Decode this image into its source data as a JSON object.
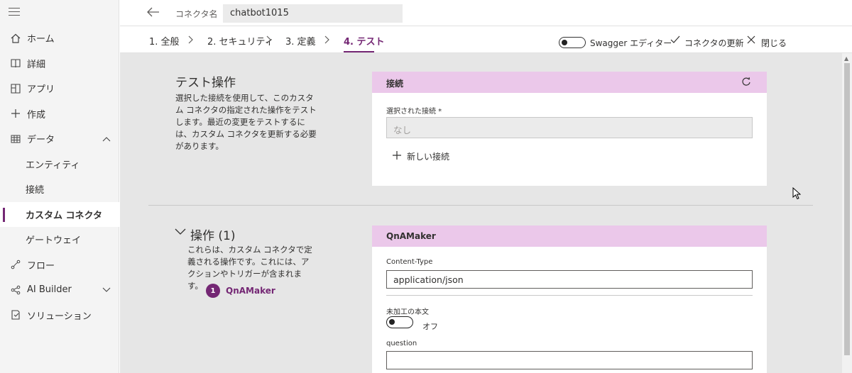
{
  "sidebar": {
    "items": [
      {
        "label": "ホーム",
        "icon": "home-icon"
      },
      {
        "label": "詳細",
        "icon": "book-icon"
      },
      {
        "label": "アプリ",
        "icon": "apps-icon"
      },
      {
        "label": "作成",
        "icon": "plus-icon"
      },
      {
        "label": "データ",
        "icon": "table-icon"
      },
      {
        "label": "エンティティ"
      },
      {
        "label": "接続"
      },
      {
        "label": "カスタム コネクタ"
      },
      {
        "label": "ゲートウェイ"
      },
      {
        "label": "フロー",
        "icon": "flow-icon"
      },
      {
        "label": "AI Builder",
        "icon": "ai-builder-icon"
      },
      {
        "label": "ソリューション",
        "icon": "solution-icon"
      }
    ]
  },
  "topbar": {
    "connector_label": "コネクタ名",
    "connector_name": "chatbot1015"
  },
  "tabs": [
    {
      "label": "1. 全般"
    },
    {
      "label": "2. セキュリティ"
    },
    {
      "label": "3. 定義"
    },
    {
      "label": "4. テスト"
    }
  ],
  "toolbar": {
    "swagger_label": "Swagger エディター",
    "update_label": "コネクタの更新",
    "close_label": "閉じる"
  },
  "test_section": {
    "title": "テスト操作",
    "description": "選択した接続を使用して、このカスタム コネクタの指定された操作をテストします。最近の変更をテストするには、カスタム コネクタを更新する必要があります。"
  },
  "connection_card": {
    "header": "接続",
    "selected_label": "選択された接続 *",
    "selected_value": "なし",
    "new_connection_label": "新しい接続"
  },
  "operations_section": {
    "title": "操作 (1)",
    "description": "これらは、カスタム コネクタで定義される操作です。これには、アクションやトリガーが含まれます。",
    "operations": [
      {
        "number": "1",
        "name": "QnAMaker"
      }
    ]
  },
  "operation_card": {
    "header": "QnAMaker",
    "content_type_label": "Content-Type",
    "content_type_value": "application/json",
    "raw_body_label": "未加工の本文",
    "raw_body_state": "オフ",
    "question_label": "question",
    "question_value": ""
  },
  "colors": {
    "accent": "#742774",
    "card_header": "#ebc8ea"
  }
}
